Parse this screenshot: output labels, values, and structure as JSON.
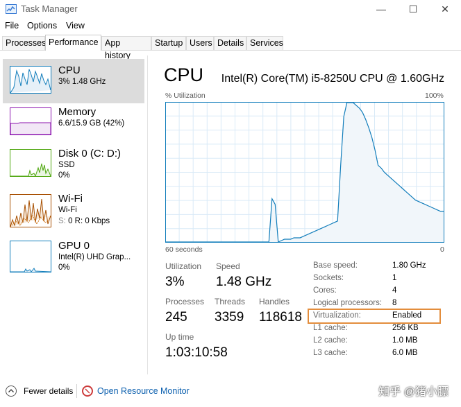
{
  "window": {
    "title": "Task Manager",
    "controls": [
      "—",
      "☐",
      "✕"
    ]
  },
  "menu": [
    "File",
    "Options",
    "View"
  ],
  "tabs": [
    "Processes",
    "Performance",
    "App history",
    "Startup",
    "Users",
    "Details",
    "Services"
  ],
  "active_tab": "Performance",
  "sidebar": {
    "items": [
      {
        "name": "CPU",
        "line1": "3% 1.48 GHz",
        "line2": "",
        "color": "#117dbb"
      },
      {
        "name": "Memory",
        "line1": "6.6/15.9 GB (42%)",
        "line2": "",
        "color": "#8b12ae"
      },
      {
        "name": "Disk 0 (C: D:)",
        "line1": "SSD",
        "line2": "0%",
        "color": "#4da60c"
      },
      {
        "name": "Wi-Fi",
        "line1": "Wi-Fi",
        "line2_prefix": "S: ",
        "line2": "0 R: 0 Kbps",
        "color": "#a74f01"
      },
      {
        "name": "GPU 0",
        "line1": "Intel(R) UHD Grap...",
        "line2": "0%",
        "color": "#117dbb"
      }
    ]
  },
  "main": {
    "title": "CPU",
    "model": "Intel(R) Core(TM) i5-8250U CPU @ 1.60GHz",
    "graph_label_left": "% Utilization",
    "graph_label_right": "100%",
    "graph_time_left": "60 seconds",
    "graph_time_right": "0",
    "graph_color": "#117dbb",
    "graph_fill": "#f1f6fa",
    "utilization_series": [
      0,
      0,
      0,
      0,
      0,
      0,
      0,
      0,
      0,
      0,
      0,
      0,
      0,
      0,
      0,
      0,
      0,
      0,
      0,
      0,
      0,
      0,
      0,
      0,
      0,
      0,
      0,
      0,
      0,
      0,
      0,
      0,
      0,
      0,
      31,
      27,
      0,
      1,
      2,
      2,
      2,
      3,
      3,
      3,
      4,
      5,
      6,
      7,
      8,
      9,
      10,
      11,
      12,
      13,
      14,
      15,
      55,
      90,
      100,
      100,
      100,
      98,
      96,
      93,
      88,
      82,
      75,
      66,
      55,
      53,
      50,
      48,
      46,
      44,
      42,
      40,
      38,
      36,
      34,
      32,
      30,
      29,
      28,
      27,
      26,
      25,
      24,
      23,
      22,
      22
    ]
  },
  "stats": {
    "utilization_label": "Utilization",
    "utilization": "3%",
    "speed_label": "Speed",
    "speed": "1.48 GHz",
    "processes_label": "Processes",
    "processes": "245",
    "threads_label": "Threads",
    "threads": "3359",
    "handles_label": "Handles",
    "handles": "118618",
    "uptime_label": "Up time",
    "uptime": "1:03:10:58"
  },
  "specs": [
    {
      "key": "Base speed:",
      "value": "1.80 GHz"
    },
    {
      "key": "Sockets:",
      "value": "1"
    },
    {
      "key": "Cores:",
      "value": "4"
    },
    {
      "key": "Logical processors:",
      "value": "8"
    },
    {
      "key": "Virtualization:",
      "value": "Enabled"
    },
    {
      "key": "L1 cache:",
      "value": "256 KB"
    },
    {
      "key": "L2 cache:",
      "value": "1.0 MB"
    },
    {
      "key": "L3 cache:",
      "value": "6.0 MB"
    }
  ],
  "highlight_color": "#e38d3c",
  "footer": {
    "fewer_details": "Fewer details",
    "open_resmon": "Open Resource Monitor"
  },
  "watermark": "知乎 @猪小膘"
}
